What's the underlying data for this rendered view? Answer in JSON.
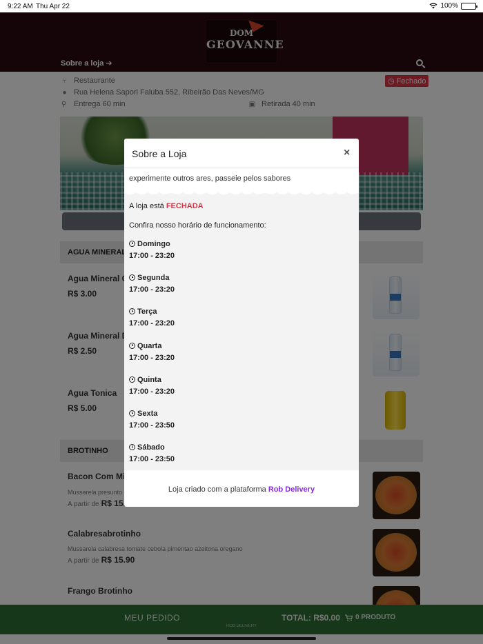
{
  "status_bar": {
    "time": "9:22 AM",
    "date": "Thu Apr 22",
    "battery": "100%"
  },
  "header": {
    "logo_line1": "DOM",
    "logo_line2": "GEOVANNE",
    "about_link": "Sobre a loja ➔"
  },
  "store_info": {
    "category": "Restaurante",
    "address": "Rua Helena Sapori Faluba 552, Ribeirão Das Neves/MG",
    "delivery": "Entrega 60 min",
    "pickup": "Retirada 40 min",
    "status_badge": "Fechado"
  },
  "sections": [
    {
      "title": "AGUA MINERAL",
      "products": [
        {
          "name": "Agua Mineral Co",
          "price": "R$ 3.00"
        },
        {
          "name": "Agua Mineral De",
          "price": "R$ 2.50"
        },
        {
          "name": "Agua Tonica",
          "price": "R$ 5.00"
        }
      ]
    },
    {
      "title": "BROTINHO",
      "products": [
        {
          "name": "Bacon Com Mill",
          "desc": "Mussarela presunto b",
          "from": "A partir de",
          "price": "R$ 15.9"
        },
        {
          "name": "Calabresabrotinho",
          "desc": "Mussarela calabresa tomate cebola pimentao azeitona oregano",
          "from": "A partir de",
          "price": "R$ 15.90"
        },
        {
          "name": "Frango Brotinho"
        }
      ]
    }
  ],
  "modal": {
    "title": "Sobre a Loja",
    "close": "×",
    "tagline": "experimente outros ares, passeie pelos sabores",
    "status_prefix": "A loja está",
    "status_value": "FECHADA",
    "hours_intro": "Confira nosso horário de funcionamento:",
    "hours": [
      {
        "day": "Domingo",
        "time": "17:00 - 23:20"
      },
      {
        "day": "Segunda",
        "time": "17:00 - 23:20"
      },
      {
        "day": "Terça",
        "time": "17:00 - 23:20"
      },
      {
        "day": "Quarta",
        "time": "17:00 - 23:20"
      },
      {
        "day": "Quinta",
        "time": "17:00 - 23:20"
      },
      {
        "day": "Sexta",
        "time": "17:00 - 23:50"
      },
      {
        "day": "Sábado",
        "time": "17:00 - 23:50"
      }
    ],
    "footer_prefix": "Loja criado com a plataforma",
    "footer_brand": "Rob Delivery"
  },
  "bottom_bar": {
    "my_order": "MEU PEDIDO",
    "total": "TOTAL: R$0.00",
    "cart": "0 PRODUTO",
    "brand": "ROB DELIVERY"
  },
  "colors": {
    "header_bg": "#2a0a12",
    "closed_red": "#dc3545",
    "bottom_green": "#2f6e35",
    "brand_purple": "#8a2be2"
  },
  "icons": [
    "wifi-icon",
    "battery-icon",
    "search-icon",
    "fork-knife-icon",
    "map-pin-icon",
    "motorcycle-icon",
    "store-icon",
    "clock-icon",
    "cart-icon",
    "close-icon"
  ]
}
